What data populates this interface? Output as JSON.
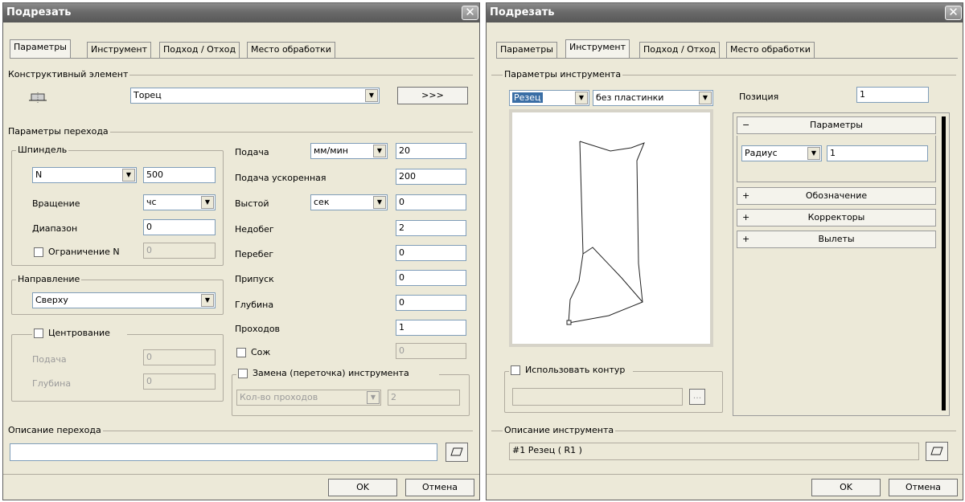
{
  "left": {
    "title": "Подрезать",
    "tabs": [
      "Параметры",
      "Инструмент",
      "Подход / Отход",
      "Место обработки"
    ],
    "active_tab": 0,
    "struct_element": {
      "legend": "Конструктивный элемент",
      "value": "Торец",
      "more_button": ">>>"
    },
    "transition": {
      "legend": "Параметры перехода",
      "spindle": {
        "legend": "Шпиндель",
        "mode": "N",
        "speed": "500",
        "rotation_label": "Вращение",
        "rotation_value": "чс",
        "range_label": "Диапазон",
        "range_value": "0",
        "limit_label": "Ограничение N",
        "limit_value": "0"
      },
      "direction": {
        "legend": "Направление",
        "value": "Сверху"
      },
      "centering": {
        "legend": "Центрование",
        "feed_label": "Подача",
        "feed_value": "0",
        "depth_label": "Глубина",
        "depth_value": "0"
      },
      "feed_label": "Подача",
      "feed_unit": "мм/мин",
      "feed_value": "20",
      "rapid_feed_label": "Подача ускоренная",
      "rapid_feed_value": "200",
      "dwell_label": "Выстой",
      "dwell_unit": "сек",
      "dwell_value": "0",
      "underrun_label": "Недобег",
      "underrun_value": "2",
      "overrun_label": "Перебег",
      "overrun_value": "0",
      "allowance_label": "Припуск",
      "allowance_value": "0",
      "depth_label": "Глубина",
      "depth_value": "0",
      "passes_label": "Проходов",
      "passes_value": "1",
      "coolant_label": "Сож",
      "coolant_value": "0",
      "tool_change": {
        "legend": "Замена (переточка) инструмента",
        "mode": "Кол-во проходов",
        "value": "2"
      }
    },
    "description_legend": "Описание перехода",
    "description_value": "",
    "ok": "OK",
    "cancel": "Отмена"
  },
  "right": {
    "title": "Подрезать",
    "tabs": [
      "Параметры",
      "Инструмент",
      "Подход / Отход",
      "Место обработки"
    ],
    "active_tab": 1,
    "tool_params_legend": "Параметры инструмента",
    "tool_type": "Резец",
    "insert_type": "без пластинки",
    "position_label": "Позиция",
    "position_value": "1",
    "panel_params": "Параметры",
    "radius_label": "Радиус",
    "radius_value": "1",
    "panel_items": [
      "Обозначение",
      "Корректоры",
      "Вылеты"
    ],
    "use_contour_label": "Использовать контур",
    "contour_button": "...",
    "tool_desc_legend": "Описание инструмента",
    "tool_desc_value": "#1 Резец ( R1 )",
    "ok": "OK",
    "cancel": "Отмена"
  },
  "close_symbol": "✕",
  "expand_symbol": "−",
  "collapse_symbol": "+",
  "dropdown_symbol": "▼"
}
